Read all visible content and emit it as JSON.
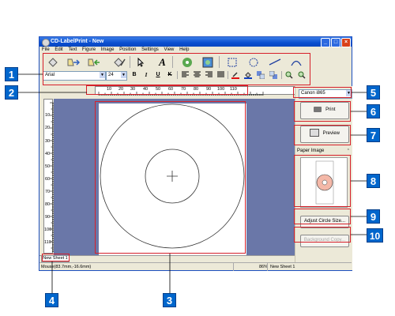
{
  "window": {
    "title": "CD-LabelPrint - New",
    "controls": {
      "minimize": "_",
      "maximize": "□",
      "close": "×"
    }
  },
  "menu": {
    "items": [
      "File",
      "Edit",
      "Text",
      "Figure",
      "Image",
      "Position",
      "Settings",
      "View",
      "Help"
    ]
  },
  "toolbar": {
    "font_name": "Arial",
    "font_size": "24",
    "format_buttons": [
      "B",
      "I",
      "U",
      "K"
    ]
  },
  "ruler": {
    "h_ticks": [
      "10",
      "20",
      "30",
      "40",
      "50",
      "60",
      "70",
      "80",
      "90",
      "100",
      "110"
    ],
    "v_ticks": [
      "10",
      "20",
      "30",
      "40",
      "50",
      "60",
      "70",
      "80",
      "90",
      "100",
      "110"
    ]
  },
  "panel": {
    "printer": "Canon i865",
    "print_label": "Print",
    "preview_label": "Preview",
    "paper_image_title": "Paper Image",
    "adjust_label": "Adjust Circle Size...",
    "disabled_label": "Background Copy..."
  },
  "sheet": {
    "tab_label": "New Sheet 1"
  },
  "status": {
    "coords": "Mouse(83.7mm,-16.6mm)",
    "zoom": "86%",
    "sheet": "New Sheet 1"
  },
  "callouts": [
    "1",
    "2",
    "3",
    "4",
    "5",
    "6",
    "7",
    "8",
    "9",
    "10"
  ],
  "colors": {
    "callout_blue": "#0066cc",
    "highlight_red": "#d6202a",
    "canvas_bg": "#6a77a8",
    "titlebar": "#0a4fd0",
    "paper_disc": "#f4b8a8"
  }
}
